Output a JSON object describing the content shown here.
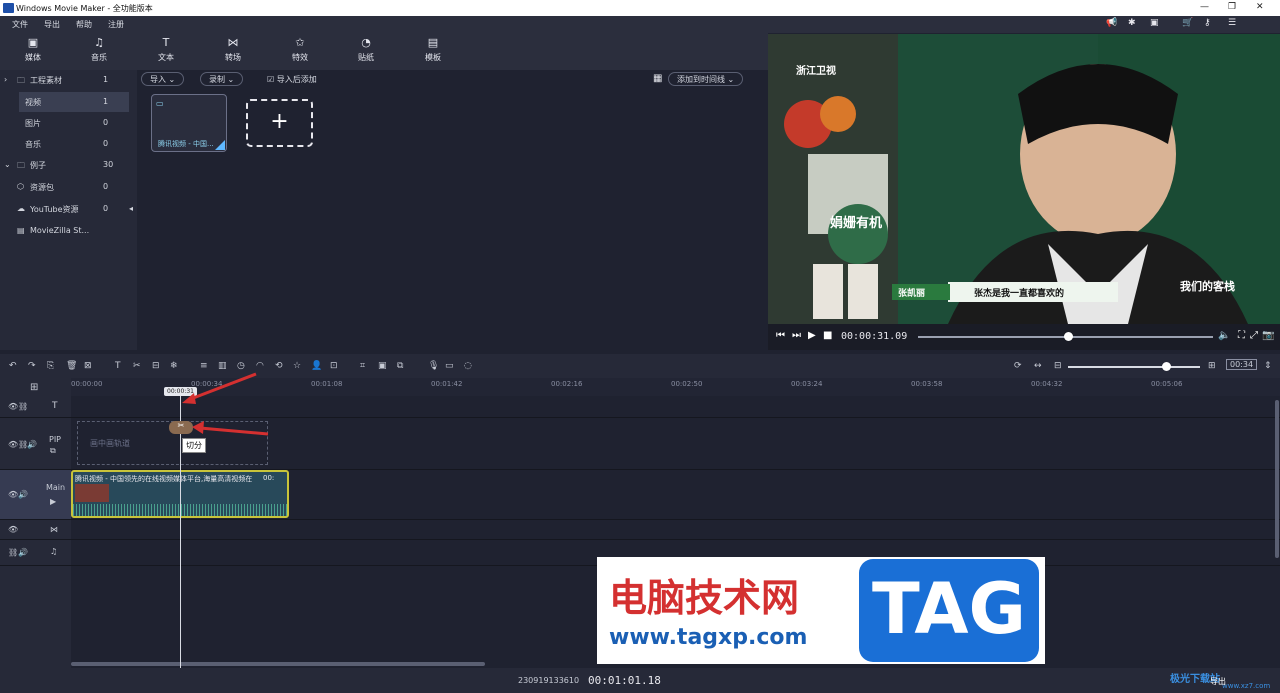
{
  "window": {
    "title": "Windows Movie Maker  - 全功能版本",
    "logo_icon": "movie-maker-logo"
  },
  "menu": [
    "文件",
    "导出",
    "帮助",
    "注册"
  ],
  "toolbar": [
    {
      "label": "媒体",
      "icon": "media-icon",
      "glyph": "▣"
    },
    {
      "label": "音乐",
      "icon": "music-icon",
      "glyph": "♫"
    },
    {
      "label": "文本",
      "icon": "text-icon",
      "glyph": "T"
    },
    {
      "label": "转场",
      "icon": "transition-icon",
      "glyph": "⋈"
    },
    {
      "label": "特效",
      "icon": "effects-icon",
      "glyph": "✩"
    },
    {
      "label": "贴纸",
      "icon": "sticker-icon",
      "glyph": "◔"
    },
    {
      "label": "模板",
      "icon": "template-icon",
      "glyph": "▤"
    }
  ],
  "sidebar": [
    {
      "label": "工程素材",
      "count": "1"
    },
    {
      "label": "视频",
      "count": "1"
    },
    {
      "label": "图片",
      "count": "0"
    },
    {
      "label": "音乐",
      "count": "0"
    },
    {
      "label": "例子",
      "count": "30"
    },
    {
      "label": "资源包",
      "count": "0"
    },
    {
      "label": "YouTube资源",
      "count": "0"
    },
    {
      "label": "MovieZilla St...",
      "count": ""
    }
  ],
  "media": {
    "import_label": "导入",
    "record_label": "录制",
    "import_after_add": "导入后添加",
    "add_to_timeline": "添加到时间线",
    "clip_name": "腾讯视频 - 中国..."
  },
  "preview": {
    "channel_logo": "浙江卫视",
    "subtitle": "张杰是我一直都喜欢的",
    "name_tag": "张凯丽",
    "bottle_label": "娟姗有机",
    "show_logo": "我们的客栈",
    "timecode": "00:00:31.09",
    "playhead_progress": 0.51
  },
  "timeline": {
    "ruler_ticks": [
      "00:00:00",
      "00:00:34",
      "00:01:08",
      "00:01:42",
      "00:02:16",
      "00:02:50",
      "00:03:24",
      "00:03:58",
      "00:04:32",
      "00:05:06"
    ],
    "playhead_time": "00:00:31",
    "pip_label": "PIP",
    "pip_placeholder": "画中画轨道",
    "main_label": "Main",
    "cut_tooltip": "切分",
    "main_clip_title": "腾讯视频 - 中国领先的在线视频媒体平台,海量高清视频在",
    "main_clip_duration": "00:",
    "zoom_value": "00:34"
  },
  "status": {
    "project_id": "230919133610",
    "total_time": "00:01:01.18",
    "export_label": "导出"
  },
  "watermark": {
    "title": "电脑技术网",
    "url": "www.tagxp.com",
    "tag": "TAG",
    "corner_text": "极光下载站",
    "corner_url": "www.xz7.com"
  },
  "colors": {
    "accent_red": "#d43030",
    "clip_border": "#c8c43a",
    "tag_blue": "#1a6fd6"
  }
}
